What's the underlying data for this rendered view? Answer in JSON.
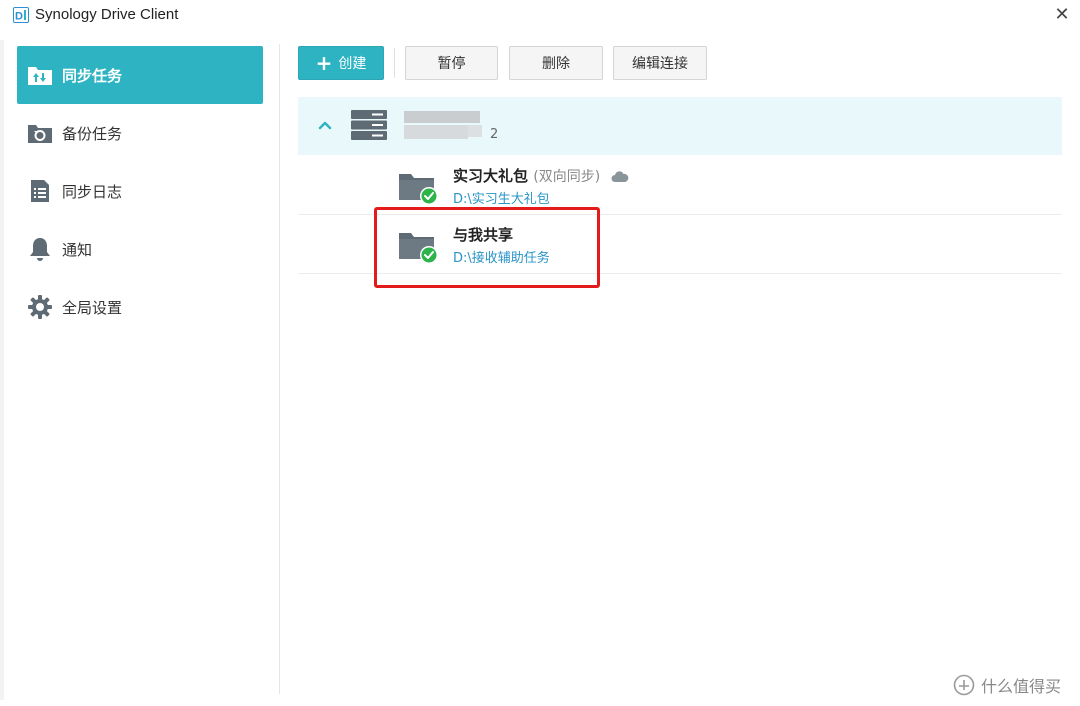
{
  "window": {
    "title": "Synology Drive Client",
    "close_glyph": "✕"
  },
  "sidebar": {
    "items": [
      {
        "label": "同步任务",
        "icon": "sync-folder-icon",
        "active": true
      },
      {
        "label": "备份任务",
        "icon": "backup-icon",
        "active": false
      },
      {
        "label": "同步日志",
        "icon": "log-list-icon",
        "active": false
      },
      {
        "label": "通知",
        "icon": "bell-icon",
        "active": false
      },
      {
        "label": "全局设置",
        "icon": "gear-icon",
        "active": false
      }
    ]
  },
  "toolbar": {
    "create_label": "创建",
    "pause_label": "暂停",
    "delete_label": "删除",
    "edit_connection_label": "编辑连接"
  },
  "server": {
    "name_suffix": "2",
    "icon": "server-icon"
  },
  "tasks": [
    {
      "name": "实习大礼包",
      "mode": "(双向同步)",
      "path": "D:\\实习生大礼包",
      "status": "synced",
      "cloud": true
    },
    {
      "name": "与我共享",
      "mode": "",
      "path": "D:\\接收辅助任务",
      "status": "synced",
      "cloud": false
    }
  ],
  "watermark": {
    "text": "什么值得买"
  },
  "colors": {
    "accent": "#2db3c2",
    "path_link": "#2a95c7",
    "status_ok": "#2cb34a",
    "highlight": "#e31b1b"
  }
}
